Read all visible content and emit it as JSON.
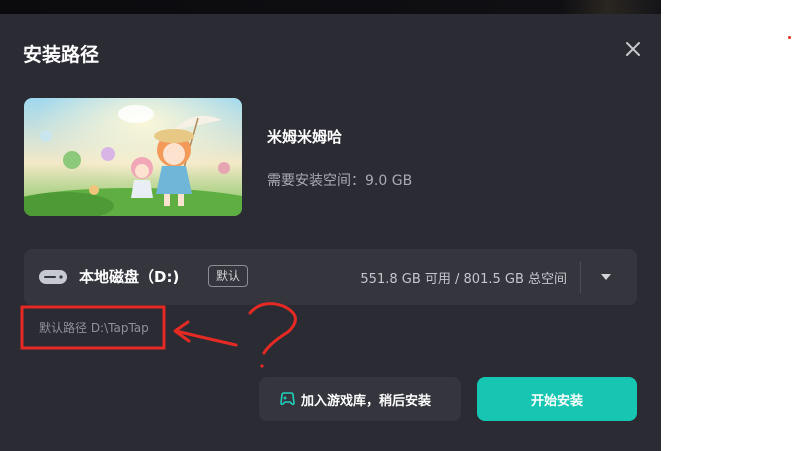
{
  "dialog": {
    "title": "安装路径",
    "close_icon": "close-icon"
  },
  "game": {
    "name": "米姆米姆哈",
    "space_label": "需要安装空间：",
    "space_value": "9.0 GB",
    "cover_icon": "game-cover-art"
  },
  "disk": {
    "icon": "hard-drive-icon",
    "name": "本地磁盘（D:)",
    "default_badge": "默认",
    "capacity": "551.8 GB 可用 / 801.5 GB 总空间",
    "dropdown_icon": "chevron-down-icon"
  },
  "default_path": "默认路径 D:\\TapTap",
  "buttons": {
    "add_to_library": "加入游戏库，稍后安装",
    "add_to_library_icon": "game-library-icon",
    "start_install": "开始安装"
  },
  "colors": {
    "dialog_bg": "#2a2b33",
    "panel_bg": "#34353d",
    "primary": "#16c6b2",
    "annotation_red": "#e52a24"
  }
}
